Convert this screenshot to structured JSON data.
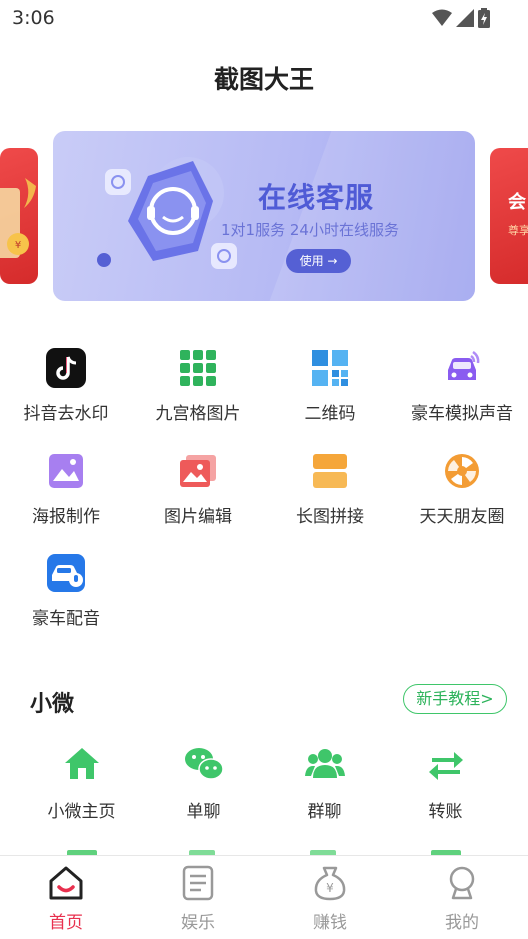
{
  "status_bar": {
    "time": "3:06"
  },
  "app_title": "截图大王",
  "banner": {
    "headline": "在线客服",
    "subtitle": "1对1服务  24小时在线服务",
    "button": "使用 →"
  },
  "side_banner_right": {
    "line1": "会",
    "line2": "尊享"
  },
  "tools": [
    {
      "label": "抖音去水印",
      "icon": "tiktok-icon"
    },
    {
      "label": "九宫格图片",
      "icon": "nine-grid-icon"
    },
    {
      "label": "二维码",
      "icon": "qrcode-icon"
    },
    {
      "label": "豪车模拟声音",
      "icon": "car-sound-icon"
    },
    {
      "label": "海报制作",
      "icon": "poster-icon"
    },
    {
      "label": "图片编辑",
      "icon": "photo-edit-icon"
    },
    {
      "label": "长图拼接",
      "icon": "long-image-icon"
    },
    {
      "label": "天天朋友圈",
      "icon": "moments-icon"
    },
    {
      "label": "豪车配音",
      "icon": "car-dubbing-icon"
    }
  ],
  "section": {
    "title": "小微",
    "tutorial": "新手教程>"
  },
  "mini_tools": [
    {
      "label": "小微主页",
      "icon": "home-icon"
    },
    {
      "label": "单聊",
      "icon": "wechat-icon"
    },
    {
      "label": "群聊",
      "icon": "group-icon"
    },
    {
      "label": "转账",
      "icon": "transfer-icon"
    }
  ],
  "tabbar": [
    {
      "label": "首页",
      "icon": "home-tab-icon",
      "active": true
    },
    {
      "label": "娱乐",
      "icon": "document-tab-icon",
      "active": false
    },
    {
      "label": "赚钱",
      "icon": "money-bag-tab-icon",
      "active": false
    },
    {
      "label": "我的",
      "icon": "profile-tab-icon",
      "active": false
    }
  ],
  "colors": {
    "accent_green": "#2db35b",
    "active_red": "#e8304e",
    "banner_blue": "#5560d4"
  }
}
